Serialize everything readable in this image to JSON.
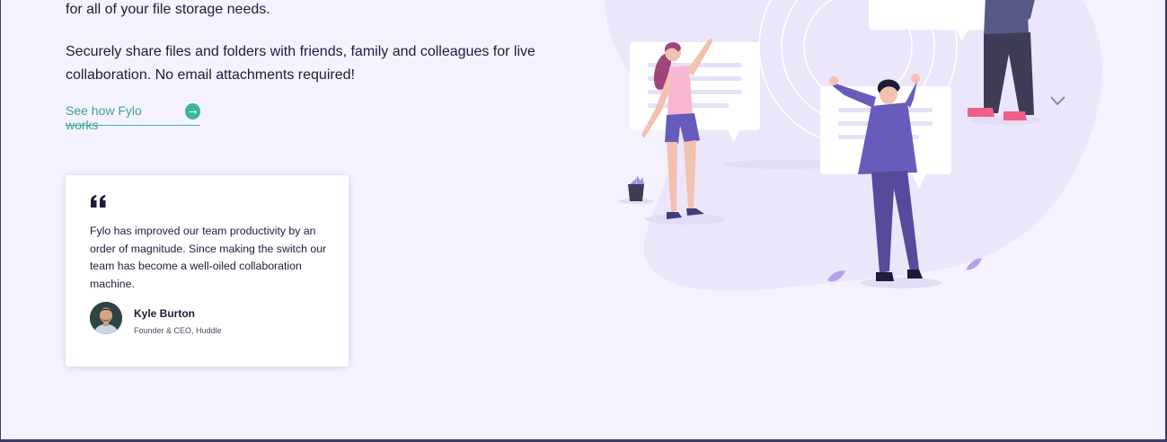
{
  "intro": {
    "line1": "for all of your file storage needs.",
    "line2": "Securely share files and folders with friends, family and colleagues for live collaboration. No email attachments required!"
  },
  "cta": {
    "label": "See how Fylo works",
    "icon": "arrow-right-icon"
  },
  "testimonial": {
    "quote": "Fylo has improved our team productivity by an order of magnitude. Since making the switch our team has become a well-oiled collaboration machine.",
    "name": "Kyle Burton",
    "role": "Founder & CEO, Huddle",
    "icons": {
      "quote": "quote-icon",
      "avatar": "avatar"
    }
  },
  "colors": {
    "background": "#f5f2ff",
    "text": "#1c1c3b",
    "accent": "#3ca493",
    "frame": "#3d3b6a"
  }
}
